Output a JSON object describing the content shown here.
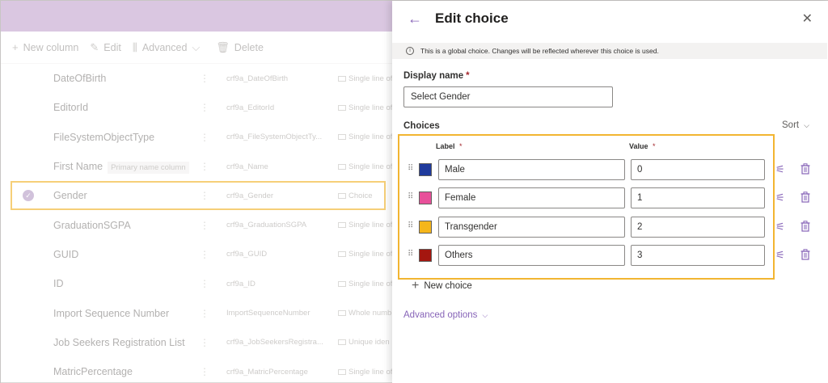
{
  "background": {
    "commands": [
      {
        "icon": "plus-icon",
        "label": "New column"
      },
      {
        "icon": "pencil-icon",
        "label": "Edit"
      },
      {
        "icon": "advanced-icon",
        "label": "Advanced"
      },
      {
        "icon": "trash-icon",
        "label": "Delete"
      }
    ],
    "rows": [
      {
        "name": "DateOfBirth",
        "chip": "",
        "schema": "crf9a_DateOfBirth",
        "type": "Single line of"
      },
      {
        "name": "EditorId",
        "chip": "",
        "schema": "crf9a_EditorId",
        "type": "Single line of"
      },
      {
        "name": "FileSystemObjectType",
        "chip": "",
        "schema": "crf9a_FileSystemObjectTy...",
        "type": "Single line of"
      },
      {
        "name": "First Name",
        "chip": "Primary name column",
        "schema": "crf9a_Name",
        "type": "Single line of"
      },
      {
        "name": "Gender",
        "chip": "",
        "schema": "crf9a_Gender",
        "type": "Choice"
      },
      {
        "name": "GraduationSGPA",
        "chip": "",
        "schema": "crf9a_GraduationSGPA",
        "type": "Single line of"
      },
      {
        "name": "GUID",
        "chip": "",
        "schema": "crf9a_GUID",
        "type": "Single line of"
      },
      {
        "name": "ID",
        "chip": "",
        "schema": "crf9a_ID",
        "type": "Single line of"
      },
      {
        "name": "Import Sequence Number",
        "chip": "",
        "schema": "ImportSequenceNumber",
        "type": "Whole numb"
      },
      {
        "name": "Job Seekers Registration List",
        "chip": "",
        "schema": "crf9a_JobSeekersRegistra...",
        "type": "Unique iden"
      },
      {
        "name": "MatricPercentage",
        "chip": "",
        "schema": "crf9a_MatricPercentage",
        "type": "Single line of"
      }
    ]
  },
  "panel": {
    "title": "Edit choice",
    "info": "This is a global choice. Changes will be reflected wherever this choice is used.",
    "display_name_label": "Display name",
    "display_name_value": "Select Gender",
    "choices_label": "Choices",
    "sort_label": "Sort",
    "label_header": "Label",
    "value_header": "Value",
    "required_mark": "*",
    "choices": [
      {
        "label": "Male",
        "value": "0",
        "color": "#1f3a9c"
      },
      {
        "label": "Female",
        "value": "1",
        "color": "#e8509a"
      },
      {
        "label": "Transgender",
        "value": "2",
        "color": "#f5b61b"
      },
      {
        "label": "Others",
        "value": "3",
        "color": "#a4160f"
      }
    ],
    "new_choice_label": "New choice",
    "advanced_label": "Advanced options"
  },
  "colors": {
    "accent": "#8764b8",
    "highlight": "#f2b531"
  }
}
